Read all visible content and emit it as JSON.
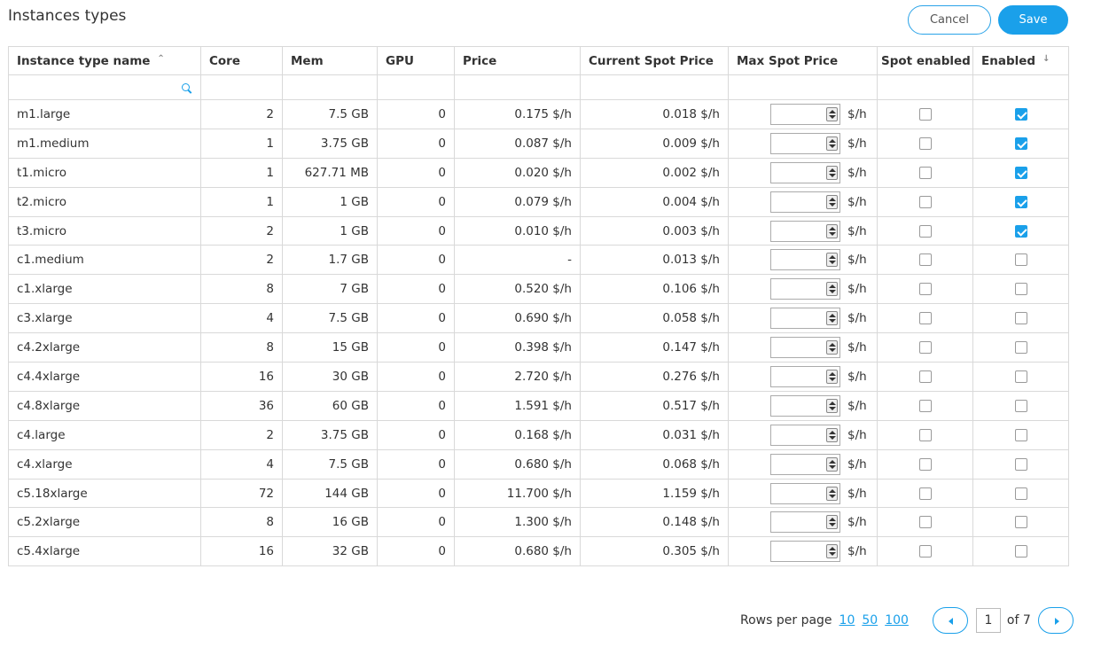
{
  "title": "Instances types",
  "toolbar": {
    "cancel_label": "Cancel",
    "save_label": "Save"
  },
  "columns": {
    "name": "Instance type name",
    "core": "Core",
    "mem": "Mem",
    "gpu": "GPU",
    "price": "Price",
    "current_spot": "Current Spot Price",
    "max_spot": "Max Spot Price",
    "spot_enabled": "Spot enabled",
    "enabled": "Enabled"
  },
  "sort": {
    "name_icon": "sort-ascending-icon",
    "enabled_icon": "sort-descending-icon"
  },
  "unit": "$/h",
  "rows": [
    {
      "name": "m1.large",
      "core": "2",
      "mem": "7.5 GB",
      "gpu": "0",
      "price": "0.175 $/h",
      "spot": "0.018 $/h",
      "spot_enabled": false,
      "enabled": true
    },
    {
      "name": "m1.medium",
      "core": "1",
      "mem": "3.75 GB",
      "gpu": "0",
      "price": "0.087 $/h",
      "spot": "0.009 $/h",
      "spot_enabled": false,
      "enabled": true
    },
    {
      "name": "t1.micro",
      "core": "1",
      "mem": "627.71 MB",
      "gpu": "0",
      "price": "0.020 $/h",
      "spot": "0.002 $/h",
      "spot_enabled": false,
      "enabled": true
    },
    {
      "name": "t2.micro",
      "core": "1",
      "mem": "1 GB",
      "gpu": "0",
      "price": "0.079 $/h",
      "spot": "0.004 $/h",
      "spot_enabled": false,
      "enabled": true
    },
    {
      "name": "t3.micro",
      "core": "2",
      "mem": "1 GB",
      "gpu": "0",
      "price": "0.010 $/h",
      "spot": "0.003 $/h",
      "spot_enabled": false,
      "enabled": true
    },
    {
      "name": "c1.medium",
      "core": "2",
      "mem": "1.7 GB",
      "gpu": "0",
      "price": "-",
      "spot": "0.013 $/h",
      "spot_enabled": false,
      "enabled": false
    },
    {
      "name": "c1.xlarge",
      "core": "8",
      "mem": "7 GB",
      "gpu": "0",
      "price": "0.520 $/h",
      "spot": "0.106 $/h",
      "spot_enabled": false,
      "enabled": false
    },
    {
      "name": "c3.xlarge",
      "core": "4",
      "mem": "7.5 GB",
      "gpu": "0",
      "price": "0.690 $/h",
      "spot": "0.058 $/h",
      "spot_enabled": false,
      "enabled": false
    },
    {
      "name": "c4.2xlarge",
      "core": "8",
      "mem": "15 GB",
      "gpu": "0",
      "price": "0.398 $/h",
      "spot": "0.147 $/h",
      "spot_enabled": false,
      "enabled": false
    },
    {
      "name": "c4.4xlarge",
      "core": "16",
      "mem": "30 GB",
      "gpu": "0",
      "price": "2.720 $/h",
      "spot": "0.276 $/h",
      "spot_enabled": false,
      "enabled": false
    },
    {
      "name": "c4.8xlarge",
      "core": "36",
      "mem": "60 GB",
      "gpu": "0",
      "price": "1.591 $/h",
      "spot": "0.517 $/h",
      "spot_enabled": false,
      "enabled": false
    },
    {
      "name": "c4.large",
      "core": "2",
      "mem": "3.75 GB",
      "gpu": "0",
      "price": "0.168 $/h",
      "spot": "0.031 $/h",
      "spot_enabled": false,
      "enabled": false
    },
    {
      "name": "c4.xlarge",
      "core": "4",
      "mem": "7.5 GB",
      "gpu": "0",
      "price": "0.680 $/h",
      "spot": "0.068 $/h",
      "spot_enabled": false,
      "enabled": false
    },
    {
      "name": "c5.18xlarge",
      "core": "72",
      "mem": "144 GB",
      "gpu": "0",
      "price": "11.700 $/h",
      "spot": "1.159 $/h",
      "spot_enabled": false,
      "enabled": false
    },
    {
      "name": "c5.2xlarge",
      "core": "8",
      "mem": "16 GB",
      "gpu": "0",
      "price": "1.300 $/h",
      "spot": "0.148 $/h",
      "spot_enabled": false,
      "enabled": false
    },
    {
      "name": "c5.4xlarge",
      "core": "16",
      "mem": "32 GB",
      "gpu": "0",
      "price": "0.680 $/h",
      "spot": "0.305 $/h",
      "spot_enabled": false,
      "enabled": false
    }
  ],
  "pagination": {
    "rows_per_page_label": "Rows per page",
    "options": [
      "10",
      "50",
      "100"
    ],
    "current_page": "1",
    "of_label": "of 7"
  },
  "colors": {
    "accent": "#1aa0ea",
    "border": "#d9d9d9"
  }
}
